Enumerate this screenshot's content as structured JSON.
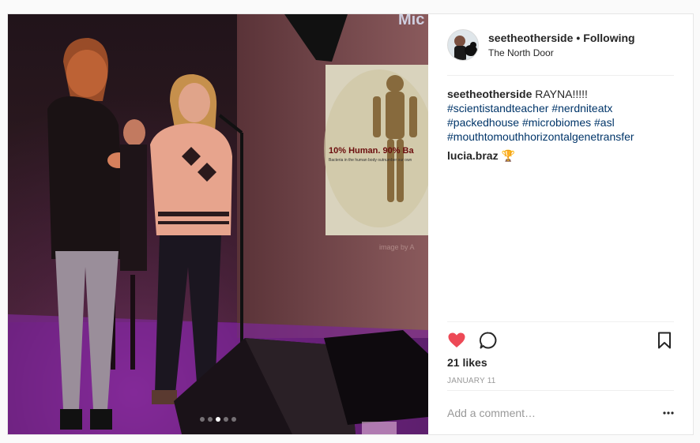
{
  "post": {
    "username": "seetheotherside",
    "separator": "•",
    "follow_status": "Following",
    "location": "The North Door",
    "slide_text": "10% Human. 90% Ba",
    "slide_subtext": "Bacteria in the human body outnumber our own",
    "slide_top": "Mic",
    "slide_credit": "image by A",
    "caption": {
      "username": "seetheotherside",
      "text": " RAYNA!!!!!",
      "tags": [
        "#scientistandteacher",
        "#nerdniteatx",
        "#packedhouse",
        "#microbiomes",
        "#asl",
        "#mouthtomouthhorizontalgenetransfer"
      ]
    },
    "comment_user": "lucia.braz",
    "comment_emoji": "🏆",
    "likes": "21 likes",
    "date": "JANUARY 11",
    "comment_placeholder": "Add a comment…",
    "carousel": {
      "count": 5,
      "active_index": 2
    },
    "icons": [
      "heart-icon",
      "comment-icon",
      "bookmark-icon",
      "more-icon"
    ],
    "colors": {
      "heart": "#ed4956",
      "link": "#003569",
      "muted": "#999999"
    }
  }
}
